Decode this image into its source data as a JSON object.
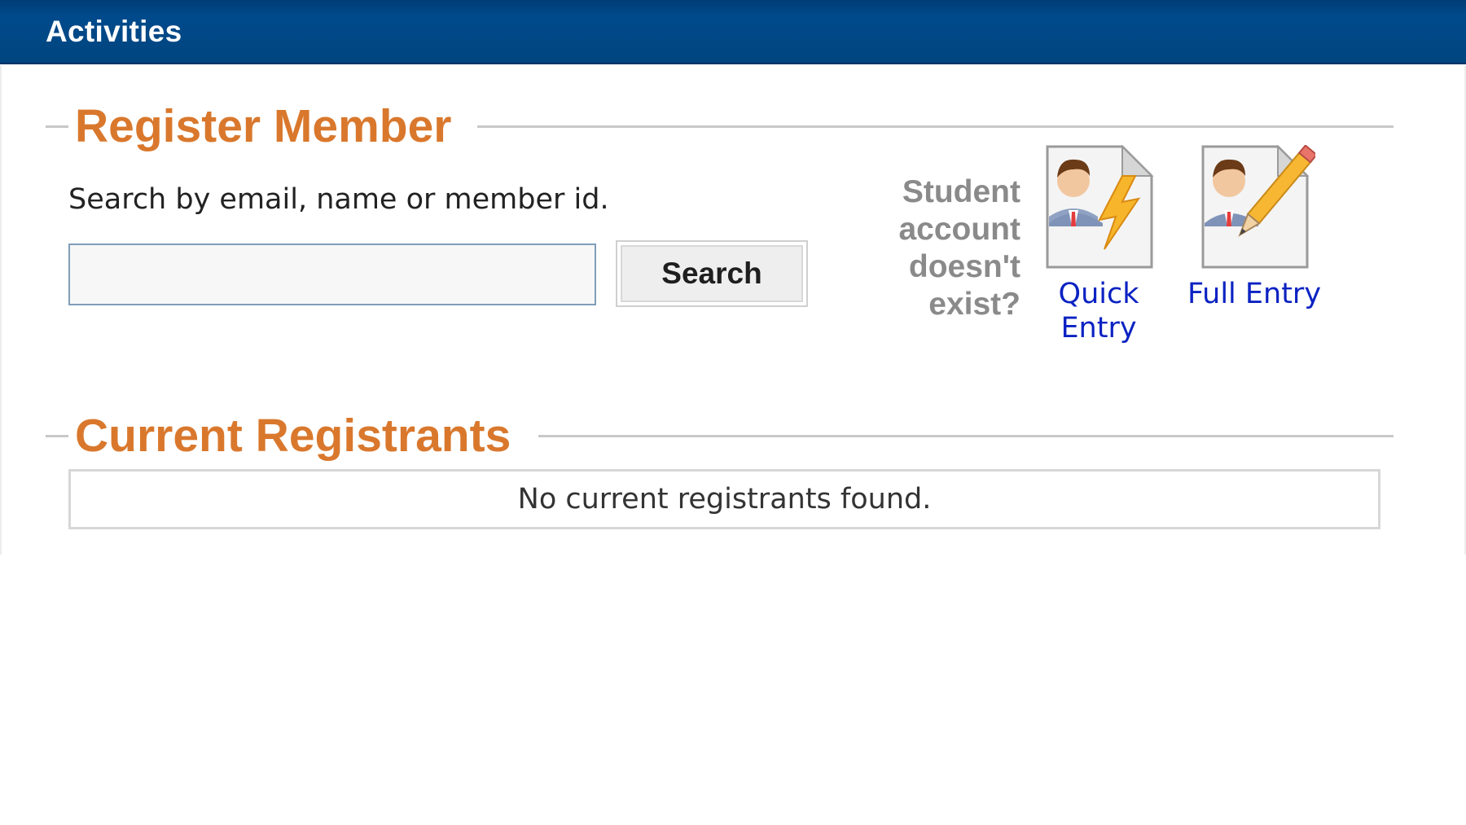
{
  "header": {
    "title": "Activities"
  },
  "register": {
    "title": "Register Member",
    "search_label": "Search by email, name or member id.",
    "search_value": "",
    "search_button": "Search",
    "no_account_text": "Student account doesn't exist?",
    "quick_entry_label": "Quick Entry",
    "full_entry_label": "Full Entry"
  },
  "registrants": {
    "title": "Current Registrants",
    "empty_message": "No current registrants found."
  },
  "colors": {
    "header_bg": "#004a8c",
    "heading_orange": "#d9782d",
    "link_blue": "#0b22c2",
    "muted_gray": "#8a8a8a"
  },
  "icons": {
    "quick_entry": "person-lightning-icon",
    "full_entry": "person-pencil-icon"
  }
}
